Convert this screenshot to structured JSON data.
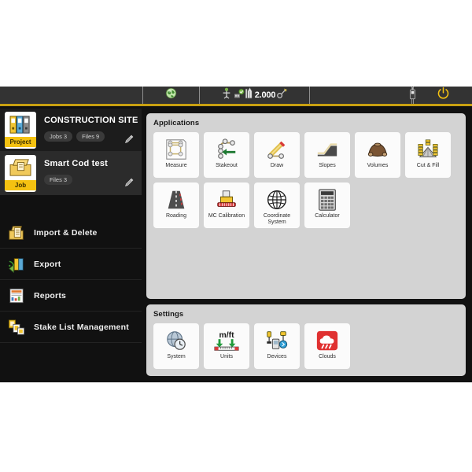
{
  "toolbar": {
    "cells": [
      {
        "name": "empty-left",
        "icon": ""
      },
      {
        "name": "gnss-globe",
        "icon": "globe-icon"
      },
      {
        "name": "status",
        "icon": "survey-status-icon"
      },
      {
        "name": "empty-right",
        "icon": ""
      },
      {
        "name": "radio",
        "icon": "radio-device-icon"
      },
      {
        "name": "power",
        "icon": "power-icon"
      }
    ],
    "precision_value": "2.000",
    "globe_label": "globe-icon",
    "radio_label": "radio-device-icon",
    "power_label": "power-icon"
  },
  "sidebar": {
    "cards": [
      {
        "tag": "Project",
        "title": "CONSTRUCTION SITE",
        "badges": [
          "Jobs 3",
          "Files 9"
        ],
        "icon": "binders-icon",
        "selected": false,
        "edit_icon": "pencil-icon"
      },
      {
        "tag": "Job",
        "title": "Smart Cod test",
        "badges": [
          "Files 3"
        ],
        "icon": "job-folder-icon",
        "selected": true,
        "edit_icon": "pencil-icon"
      }
    ],
    "menu": [
      {
        "label": "Import & Delete",
        "icon": "import-delete-icon"
      },
      {
        "label": "Export",
        "icon": "export-icon"
      },
      {
        "label": "Reports",
        "icon": "reports-icon"
      },
      {
        "label": "Stake List Management",
        "icon": "stake-list-icon"
      }
    ]
  },
  "applications": {
    "title": "Applications",
    "tiles": [
      {
        "label": "Measure",
        "icon": "measure-icon"
      },
      {
        "label": "Stakeout",
        "icon": "stakeout-icon"
      },
      {
        "label": "Draw",
        "icon": "draw-icon"
      },
      {
        "label": "Slopes",
        "icon": "slopes-icon"
      },
      {
        "label": "Volumes",
        "icon": "volumes-icon"
      },
      {
        "label": "Cut & Fill",
        "icon": "cut-fill-icon"
      },
      {
        "label": "Roading",
        "icon": "roading-icon"
      },
      {
        "label": "MC Calibration",
        "icon": "mc-calibration-icon"
      },
      {
        "label": "Coordinate System",
        "icon": "coordinate-system-icon"
      },
      {
        "label": "Calculator",
        "icon": "calculator-icon"
      }
    ]
  },
  "settings": {
    "title": "Settings",
    "tiles": [
      {
        "label": "System",
        "icon": "system-globe-clock-icon"
      },
      {
        "label": "Units",
        "icon": "units-icon",
        "text": "m/ft"
      },
      {
        "label": "Devices",
        "icon": "devices-icon"
      },
      {
        "label": "Clouds",
        "icon": "clouds-icon"
      }
    ]
  },
  "colors": {
    "accent_yellow": "#f5c211",
    "toolbar_bg": "#333333",
    "toolbar_rule": "#c8a011",
    "panel_bg": "#d3d3d3",
    "tile_bg": "#fbfbfb",
    "frame_bg": "#111111",
    "clouds_red": "#e03131"
  }
}
